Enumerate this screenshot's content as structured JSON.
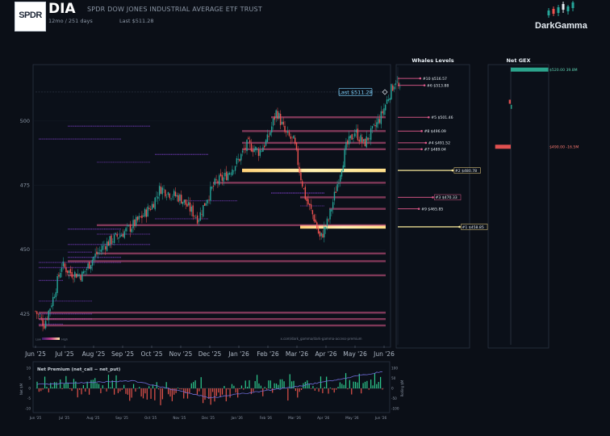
{
  "header": {
    "logo_text": "SPDR",
    "ticker": "DIA",
    "fund_name": "SPDR DOW JONES INDUSTRIAL AVERAGE ETF TRUST",
    "period": "12mo / 251 days",
    "last": "Last $511.28",
    "brand": "DarkGamma"
  },
  "colors": {
    "background": "#0b0f17",
    "candle_up": "#26a69a",
    "candle_down": "#ef5350",
    "whale_band": "#e05a8c",
    "volume_profile": "#7b3fc4",
    "gex_positive": "#2ca58d",
    "gex_negative": "#e05050",
    "premium_line": "#6f6bd6",
    "last_price": "#7fd4ff"
  },
  "chart_data": [
    {
      "type": "candlestick",
      "x_tick_labels": [
        "Jun '25",
        "Jul '25",
        "Aug '25",
        "Sep '25",
        "Oct '25",
        "Nov '25",
        "Dec '25",
        "Jan '26",
        "Feb '26",
        "Mar '26",
        "Apr '26",
        "May '26",
        "Jun '26"
      ],
      "y_tick_labels": [
        "425",
        "450",
        "475",
        "500"
      ],
      "ylim": [
        413,
        521
      ],
      "last_label": "Last $511.28",
      "last_price": 511.28,
      "watermark": "x.com/dark_gamma/dark-gamma-access-premium",
      "legend_low": "Low",
      "legend_high": "High",
      "whale_bands": [
        {
          "price": 501.46,
          "x_start": "Feb '26"
        },
        {
          "price": 496.09,
          "x_start": "Jan '26"
        },
        {
          "price": 491.52,
          "x_start": "Jan '26"
        },
        {
          "price": 489.04,
          "x_start": "Jan '26"
        },
        {
          "price": 480.78,
          "x_start": "Jan '26"
        },
        {
          "price": 476.0,
          "x_start": "Dec '25"
        },
        {
          "price": 470.33,
          "x_start": "Mar '26"
        },
        {
          "price": 465.85,
          "x_start": "Apr '26"
        },
        {
          "price": 458.85,
          "x_start": "Mar '26"
        },
        {
          "price": 459.5,
          "x_start": "Aug '25"
        },
        {
          "price": 448.5,
          "x_start": "Aug '25"
        },
        {
          "price": 445.5,
          "x_start": "Jul '25"
        },
        {
          "price": 440.0,
          "x_start": "Jul '25"
        },
        {
          "price": 425.5,
          "x_start": "Jun '25"
        },
        {
          "price": 423.0,
          "x_start": "Jun '25"
        },
        {
          "price": 420.5,
          "x_start": "Jun '25"
        }
      ]
    },
    {
      "type": "bar",
      "title": "Whales Levels",
      "levels": [
        {
          "label": "#10 $516.57",
          "price": 516.57,
          "value": 0.32,
          "color": "#e05a8c"
        },
        {
          "label": "#6 $513.88",
          "price": 513.88,
          "value": 0.38,
          "color": "#e05a8c"
        },
        {
          "label": "#5 $501.46",
          "price": 501.46,
          "value": 0.44,
          "color": "#e05a8c"
        },
        {
          "label": "#8 $496.09",
          "price": 496.09,
          "value": 0.34,
          "color": "#e05a8c"
        },
        {
          "label": "#4 $491.52",
          "price": 491.52,
          "value": 0.4,
          "color": "#e05a8c"
        },
        {
          "label": "#7 $489.04",
          "price": 489.04,
          "value": 0.34,
          "color": "#e05a8c"
        },
        {
          "label": "#2 $480.78",
          "price": 480.78,
          "value": 0.78,
          "color": "#ffef9e",
          "boxed": true
        },
        {
          "label": "#3 $470.33",
          "price": 470.33,
          "value": 0.5,
          "color": "#e05a8c",
          "boxed": true
        },
        {
          "label": "#9 $465.85",
          "price": 465.85,
          "value": 0.3,
          "color": "#e05a8c"
        },
        {
          "label": "#1 $458.85",
          "price": 458.85,
          "value": 0.88,
          "color": "#ffef9e",
          "boxed": true
        }
      ]
    },
    {
      "type": "bar",
      "title": "Net GEX",
      "bars": [
        {
          "label": "$520.00  39.8M",
          "price": 520.0,
          "value": 39.8
        },
        {
          "label": "",
          "price": 507.5,
          "value": -2.0
        },
        {
          "label": "",
          "price": 505.5,
          "value": 1.2
        },
        {
          "label": "$490.00  -16.5M",
          "price": 490.0,
          "value": -16.5
        }
      ]
    },
    {
      "type": "bar",
      "title": "Net Premium (net_call − net_put)",
      "ylabel_left": "Net $M",
      "ylabel_right": "Rolling $M",
      "left_ticks": [
        "10",
        "5",
        "0",
        "-5",
        "-10"
      ],
      "right_ticks": [
        "100",
        "50",
        "0",
        "-50",
        "-100"
      ],
      "x_tick_labels": [
        "Jun '25",
        "Jul '25",
        "Aug '25",
        "Sep '25",
        "Oct '25",
        "Nov '25",
        "Dec '25",
        "Jan '26",
        "Feb '26",
        "Mar '26",
        "Apr '26",
        "May '26",
        "Jun '26"
      ]
    }
  ]
}
